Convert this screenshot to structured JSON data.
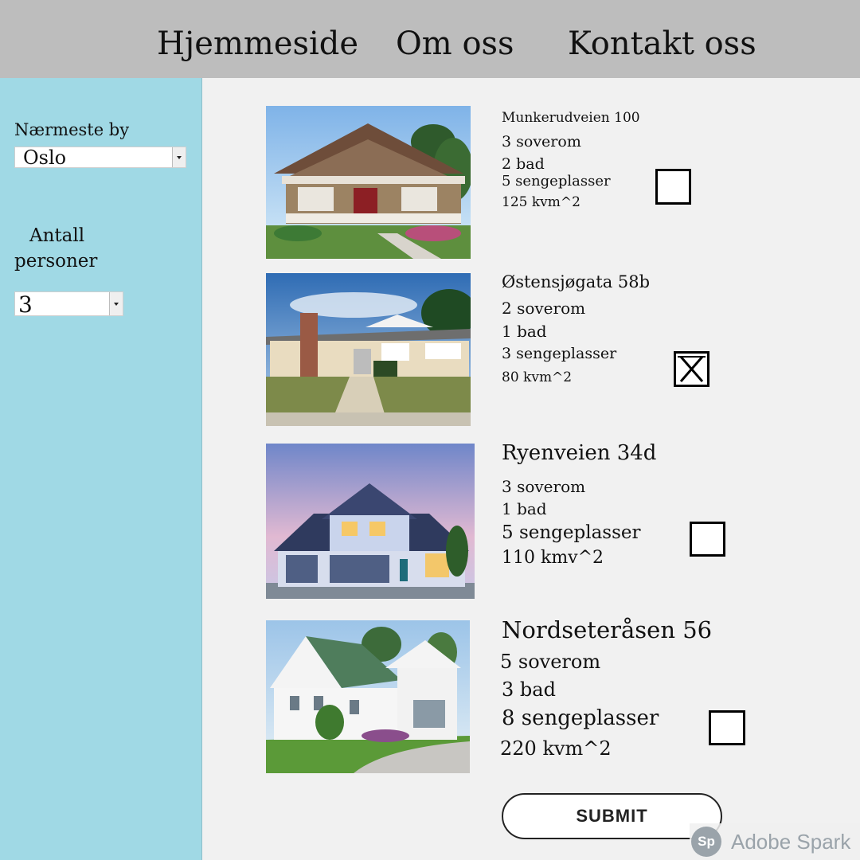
{
  "nav": {
    "home": "Hjemmeside",
    "about": "Om oss",
    "contact": "Kontakt oss"
  },
  "sidebar": {
    "city_label": "Nærmeste by",
    "city_value": "Oslo",
    "persons_label_1": "Antall",
    "persons_label_2": "personer",
    "persons_value": "3"
  },
  "listings": [
    {
      "address": "Munkerudveien 100",
      "bedrooms": "3 soverom",
      "bathrooms": "2 bad",
      "beds": "5 sengeplasser",
      "area": "125 kvm^2",
      "checked": false
    },
    {
      "address": "Østensjøgata 58b",
      "bedrooms": "2 soverom",
      "bathrooms": "1 bad",
      "beds": "3 sengeplasser",
      "area": "80 kvm^2",
      "checked": true
    },
    {
      "address": "Ryenveien 34d",
      "bedrooms": "3 soverom",
      "bathrooms": "1 bad",
      "beds": "5 sengeplasser",
      "area": "110 kmv^2",
      "checked": false
    },
    {
      "address": "Nordseteråsen 56",
      "bedrooms": "5 soverom",
      "bathrooms": "3 bad",
      "beds": "8 sengeplasser",
      "area": "220 kvm^2",
      "checked": false
    }
  ],
  "submit_label": "SUBMIT",
  "watermark": {
    "logo": "Sp",
    "text": "Adobe Spark"
  }
}
